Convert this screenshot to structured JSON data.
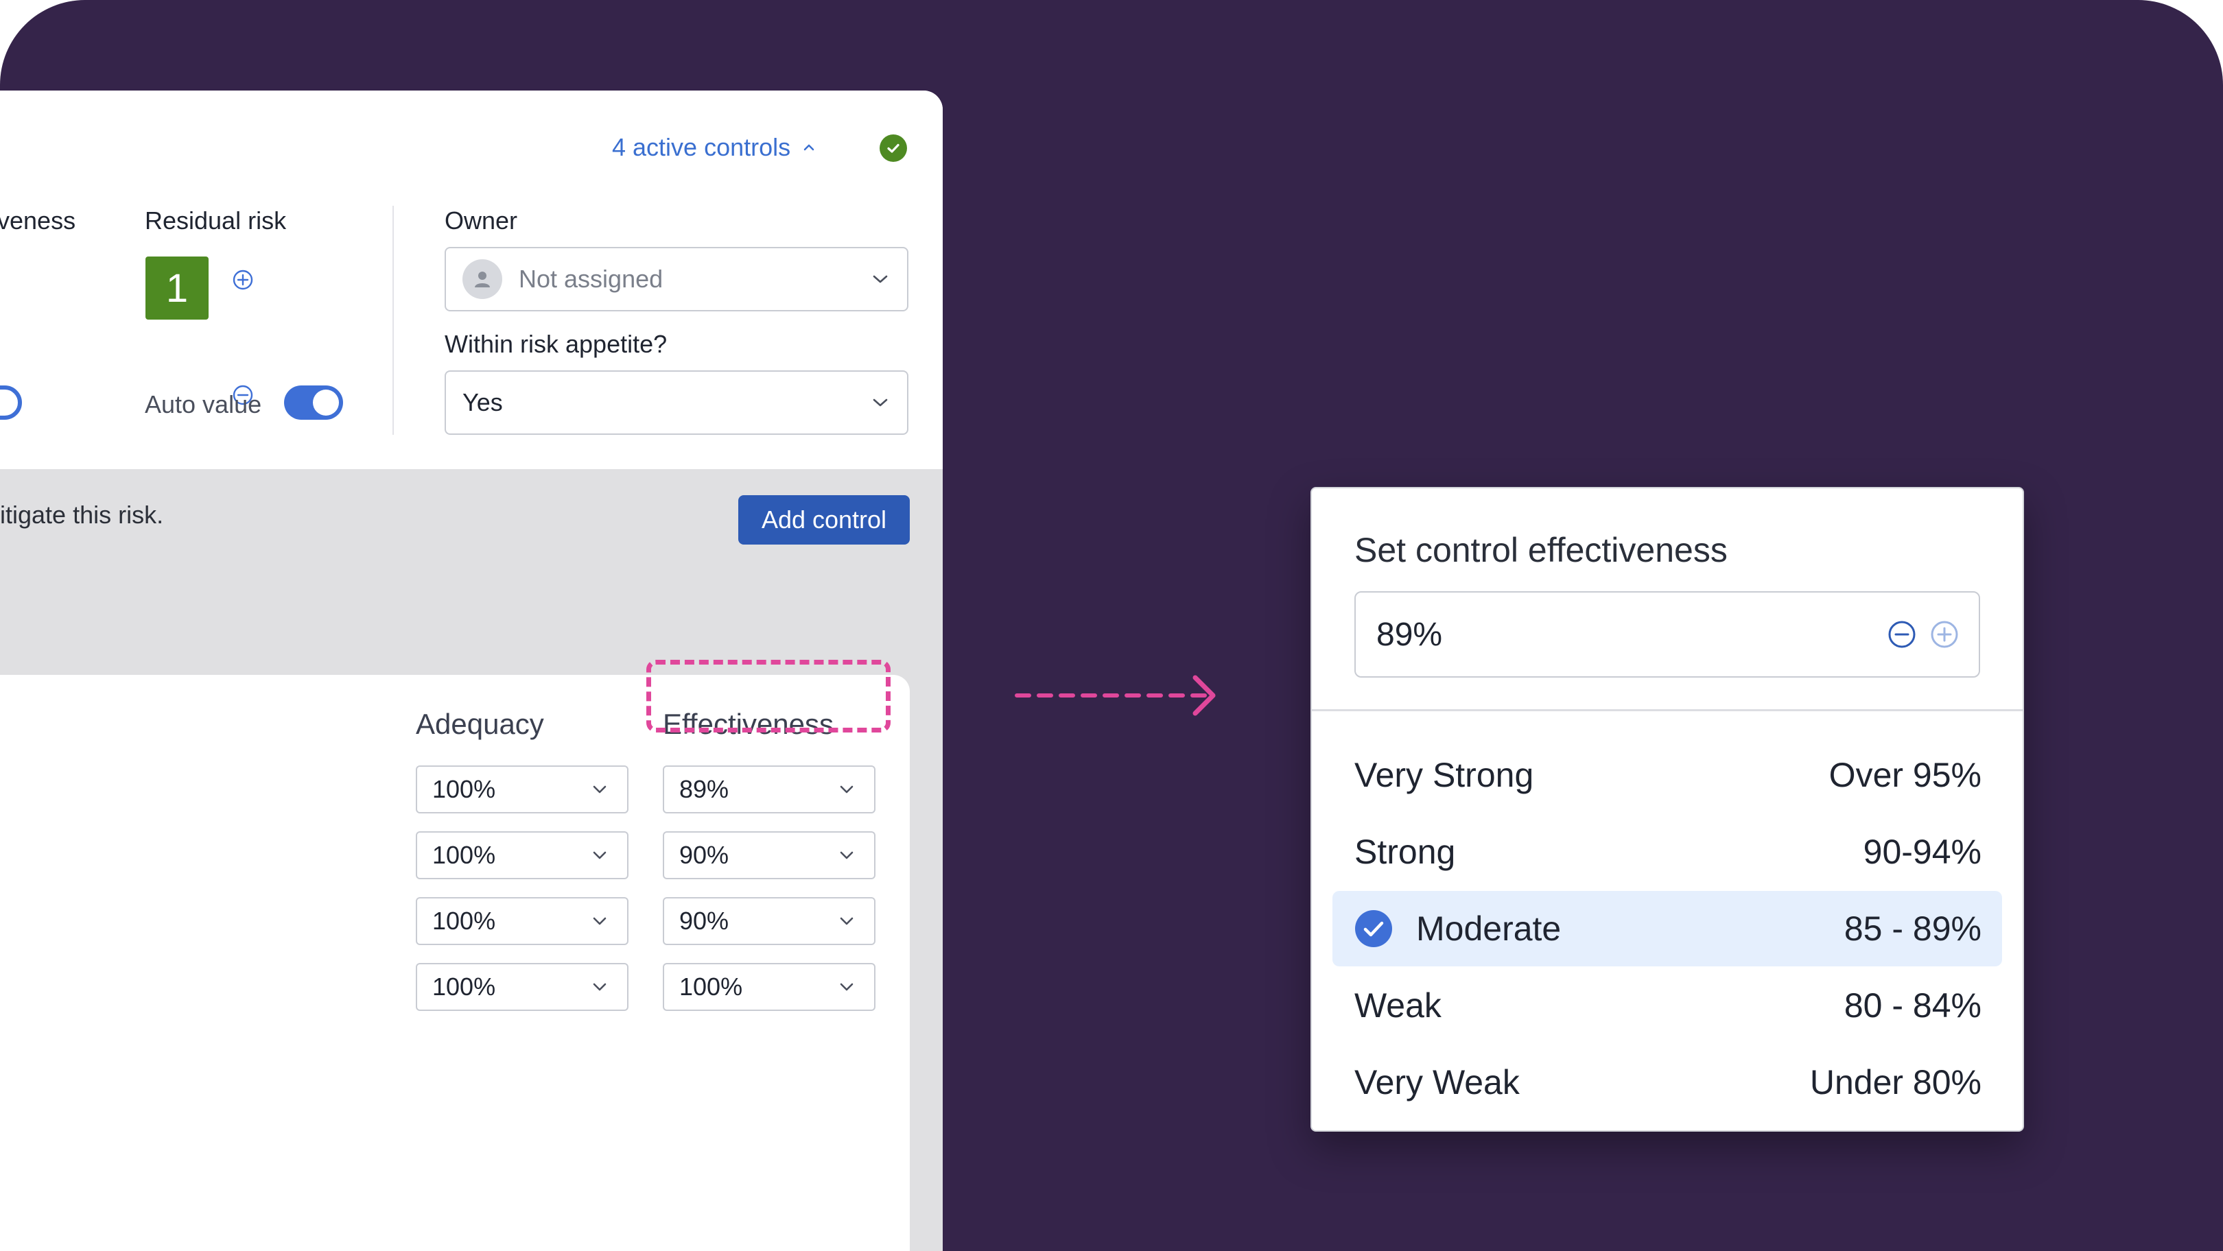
{
  "header": {
    "active_controls": "4 active controls"
  },
  "risk": {
    "effectiveness_label_partial": "veness",
    "residual_label": "Residual risk",
    "residual_value": "1",
    "auto_value_label": "Auto value",
    "auto_value_on": true
  },
  "owner": {
    "label": "Owner",
    "placeholder": "Not assigned"
  },
  "appetite": {
    "label": "Within risk appetite?",
    "value": "Yes"
  },
  "controls_section": {
    "description_partial": "itigate this risk.",
    "add_button": "Add control",
    "columns": {
      "adequacy": "Adequacy",
      "effectiveness": "Effectiveness"
    },
    "rows": [
      {
        "adequacy": "100%",
        "effectiveness": "89%"
      },
      {
        "adequacy": "100%",
        "effectiveness": "90%"
      },
      {
        "adequacy": "100%",
        "effectiveness": "90%"
      },
      {
        "adequacy": "100%",
        "effectiveness": "100%"
      }
    ]
  },
  "popover": {
    "title": "Set control effectiveness",
    "value": "89%",
    "options": [
      {
        "name": "Very Strong",
        "range": "Over 95%",
        "selected": false
      },
      {
        "name": "Strong",
        "range": "90-94%",
        "selected": false
      },
      {
        "name": "Moderate",
        "range": "85 - 89%",
        "selected": true
      },
      {
        "name": "Weak",
        "range": "80 - 84%",
        "selected": false
      },
      {
        "name": "Very Weak",
        "range": "Under 80%",
        "selected": false
      }
    ]
  },
  "colors": {
    "background": "#35244a",
    "accent_blue": "#3e6fd6",
    "button_blue": "#2d5ab4",
    "risk_green": "#4e8a22",
    "highlight_pink": "#e0479b",
    "selected_bg": "#e5effd"
  }
}
